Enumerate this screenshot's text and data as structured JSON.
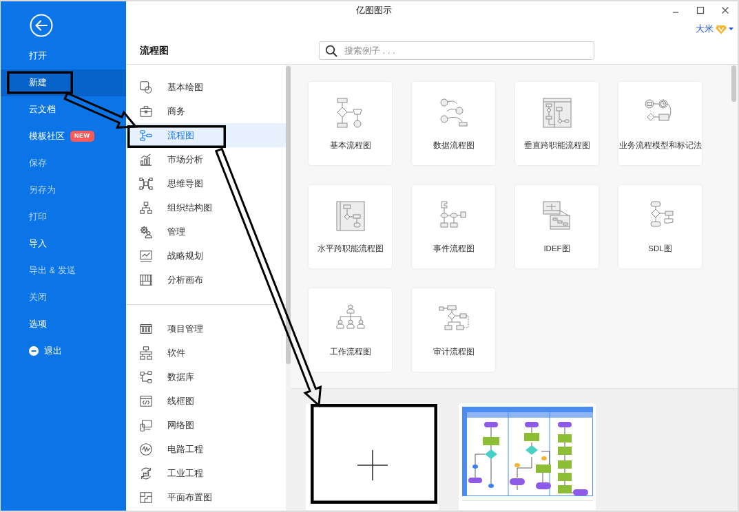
{
  "window": {
    "title": "亿图图示"
  },
  "user": {
    "name": "大米"
  },
  "sidebar": {
    "items": [
      {
        "label": "打开",
        "selected": false,
        "disabled": false,
        "annotated": false
      },
      {
        "label": "新建",
        "selected": true,
        "disabled": false,
        "annotated": true
      },
      {
        "label": "云文档",
        "selected": false,
        "disabled": false,
        "annotated": false
      },
      {
        "label": "模板社区",
        "badge": "NEW",
        "selected": false,
        "disabled": false,
        "annotated": false
      },
      {
        "label": "保存",
        "selected": false,
        "disabled": true,
        "annotated": false
      },
      {
        "label": "另存为",
        "selected": false,
        "disabled": true,
        "annotated": false
      },
      {
        "label": "打印",
        "selected": false,
        "disabled": true,
        "annotated": false
      },
      {
        "label": "导入",
        "selected": false,
        "disabled": false,
        "annotated": false
      },
      {
        "label": "导出 & 发送",
        "selected": false,
        "disabled": true,
        "annotated": false
      },
      {
        "label": "关闭",
        "selected": false,
        "disabled": true,
        "annotated": false
      },
      {
        "label": "选项",
        "selected": false,
        "disabled": false,
        "annotated": false
      }
    ],
    "exit": {
      "label": "退出"
    }
  },
  "page": {
    "title": "流程图"
  },
  "search": {
    "placeholder": "搜索例子 . . ."
  },
  "category_groups": [
    {
      "items": [
        {
          "label": "基本绘图",
          "selected": false,
          "annotated": false
        },
        {
          "label": "商务",
          "selected": false,
          "annotated": false
        },
        {
          "label": "流程图",
          "selected": true,
          "annotated": true
        },
        {
          "label": "市场分析",
          "selected": false,
          "annotated": false
        },
        {
          "label": "思维导图",
          "selected": false,
          "annotated": false
        },
        {
          "label": "组织结构图",
          "selected": false,
          "annotated": false
        },
        {
          "label": "管理",
          "selected": false,
          "annotated": false
        },
        {
          "label": "战略规划",
          "selected": false,
          "annotated": false
        },
        {
          "label": "分析画布",
          "selected": false,
          "annotated": false
        }
      ]
    },
    {
      "items": [
        {
          "label": "项目管理",
          "selected": false,
          "annotated": false
        },
        {
          "label": "软件",
          "selected": false,
          "annotated": false
        },
        {
          "label": "数据库",
          "selected": false,
          "annotated": false
        },
        {
          "label": "线框图",
          "selected": false,
          "annotated": false
        },
        {
          "label": "网络图",
          "selected": false,
          "annotated": false
        },
        {
          "label": "电路工程",
          "selected": false,
          "annotated": false
        },
        {
          "label": "工业工程",
          "selected": false,
          "annotated": false
        },
        {
          "label": "平面布置图",
          "selected": false,
          "annotated": false
        }
      ]
    }
  ],
  "templates": [
    {
      "label": "基本流程图"
    },
    {
      "label": "数据流程图"
    },
    {
      "label": "垂直跨职能流程图"
    },
    {
      "label": "业务流程模型和标记法"
    },
    {
      "label": "水平跨职能流程图"
    },
    {
      "label": "事件流程图"
    },
    {
      "label": "IDEF图"
    },
    {
      "label": "SDL图"
    },
    {
      "label": "工作流程图"
    },
    {
      "label": "审计流程图"
    }
  ],
  "examples": [
    {
      "kind": "blank",
      "annotated": true
    },
    {
      "kind": "sample",
      "annotated": false
    }
  ]
}
